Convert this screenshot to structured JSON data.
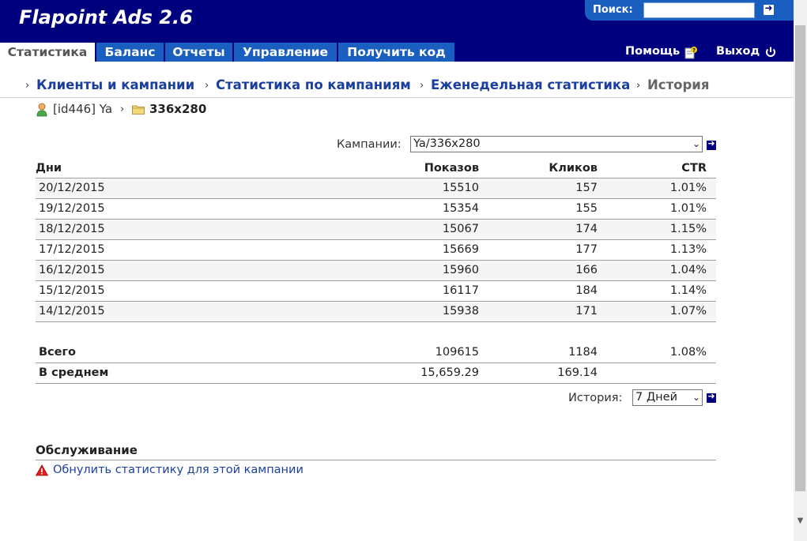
{
  "header": {
    "title": "Flapoint Ads 2.6",
    "search_label": "Поиск:",
    "search_value": "",
    "search_go_icon": "arrow-right-icon",
    "help_label": "Помощь",
    "logout_label": "Выход"
  },
  "tabs": [
    {
      "label": "Статистика",
      "active": true
    },
    {
      "label": "Баланс",
      "active": false
    },
    {
      "label": "Отчеты",
      "active": false
    },
    {
      "label": "Управление",
      "active": false
    },
    {
      "label": "Получить код",
      "active": false
    }
  ],
  "breadcrumb": {
    "separator": "›",
    "items": [
      {
        "label": "Клиенты и кампании"
      },
      {
        "label": "Статистика по кампаниям"
      },
      {
        "label": "Еженедельная статистика"
      },
      {
        "label": "История"
      }
    ]
  },
  "path": {
    "user": "[id446] Ya",
    "separator": "›",
    "folder": "336x280"
  },
  "campaign": {
    "label": "Кампании:",
    "selected": "Ya/336x280"
  },
  "table": {
    "headers": {
      "day": "Дни",
      "shows": "Показов",
      "clicks": "Кликов",
      "ctr": "CTR"
    },
    "rows": [
      {
        "day": "20/12/2015",
        "shows": "15510",
        "clicks": "157",
        "ctr": "1.01%"
      },
      {
        "day": "19/12/2015",
        "shows": "15354",
        "clicks": "155",
        "ctr": "1.01%"
      },
      {
        "day": "18/12/2015",
        "shows": "15067",
        "clicks": "174",
        "ctr": "1.15%"
      },
      {
        "day": "17/12/2015",
        "shows": "15669",
        "clicks": "177",
        "ctr": "1.13%"
      },
      {
        "day": "16/12/2015",
        "shows": "15960",
        "clicks": "166",
        "ctr": "1.04%"
      },
      {
        "day": "15/12/2015",
        "shows": "16117",
        "clicks": "184",
        "ctr": "1.14%"
      },
      {
        "day": "14/12/2015",
        "shows": "15938",
        "clicks": "171",
        "ctr": "1.07%"
      }
    ],
    "total": {
      "label": "Всего",
      "shows": "109615",
      "clicks": "1184",
      "ctr": "1.08%"
    },
    "average": {
      "label": "В среднем",
      "shows": "15,659.29",
      "clicks": "169.14"
    }
  },
  "history": {
    "label": "История:",
    "selected": "7 Дней"
  },
  "maintenance": {
    "title": "Обслуживание",
    "reset_link": "Обнулить статистику для этой кампании"
  },
  "colors": {
    "header_bg": "#00007f",
    "tab_bg": "#1a5fc0",
    "link": "#1a3f9e"
  }
}
